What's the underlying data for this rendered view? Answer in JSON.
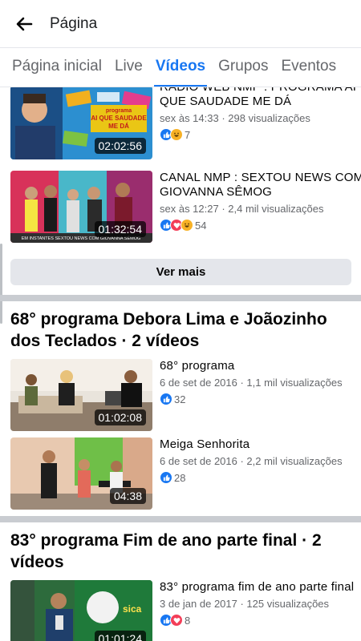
{
  "header": {
    "back_icon": "arrow-left-icon",
    "title": "Página"
  },
  "tabs": [
    {
      "label": "Página inicial",
      "active": false
    },
    {
      "label": "Live",
      "active": false
    },
    {
      "label": "Vídeos",
      "active": true
    },
    {
      "label": "Grupos",
      "active": false
    },
    {
      "label": "Eventos",
      "active": false
    }
  ],
  "recent": {
    "videos": [
      {
        "title": "RADIO WEB NMP : PROGRAMA AI QUE SAUDADE ME DÁ",
        "meta": "sex às 14:33 · 298 visualizações",
        "duration": "02:02:56",
        "reaction_count": "7",
        "reactions": [
          "like",
          "haha"
        ],
        "thumb_text": "programa AI QUE SAUDADE ME DÁ"
      },
      {
        "title": "CANAL NMP : SEXTOU NEWS COM GIOVANNA SÊMOG",
        "meta": "sex às 12:27 · 2,4 mil visualizações",
        "duration": "01:32:54",
        "reaction_count": "54",
        "reactions": [
          "like",
          "love",
          "haha"
        ],
        "thumb_text": "EM INSTANTES SEXTOU NEWS COM GIOVANNA SÊMOG"
      }
    ],
    "more_label": "Ver mais"
  },
  "playlists": [
    {
      "title": "68° programa Debora Lima e Joãozinho dos Teclados · 2 vídeos",
      "videos": [
        {
          "title": "68° programa",
          "meta": "6 de set de 2016 · 1,1 mil visualizações",
          "duration": "01:02:08",
          "reaction_count": "32",
          "reactions": [
            "like"
          ]
        },
        {
          "title": "Meiga Senhorita",
          "meta": "6 de set de 2016 · 2,2 mil visualizações",
          "duration": "04:38",
          "reaction_count": "28",
          "reactions": [
            "like"
          ]
        }
      ]
    },
    {
      "title": "83° programa Fim de ano parte final · 2 vídeos",
      "videos": [
        {
          "title": "83° programa fim de ano parte final",
          "meta": "3 de jan de 2017 · 125 visualizações",
          "duration": "01:01:24",
          "reaction_count": "8",
          "reactions": [
            "like",
            "love"
          ]
        }
      ]
    }
  ],
  "colors": {
    "accent": "#1877f2",
    "divider": "#c9ccd1",
    "secondary_text": "#65676b"
  }
}
